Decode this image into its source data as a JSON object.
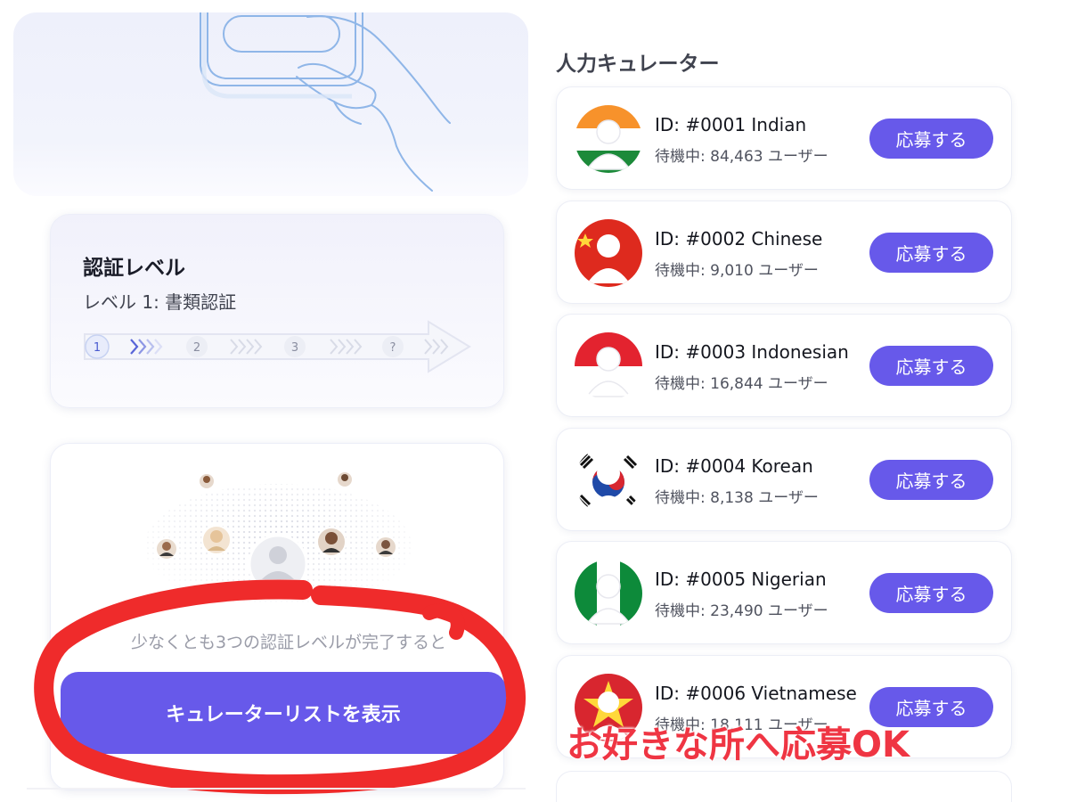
{
  "verification": {
    "title": "認証レベル",
    "subtitle": "レベル 1: 書類認証",
    "steps": [
      "1",
      "2",
      "3",
      "?"
    ]
  },
  "curator_promo": {
    "requirement_note": "少なくとも3つの認証レベルが完了すると",
    "show_list_label": "キュレーターリストを表示"
  },
  "curators": {
    "section_title": "人力キュレーター",
    "items": [
      {
        "name": "ID: #0001 Indian",
        "waiting": "待機中: 84,463 ユーザー",
        "apply_label": "応募する",
        "flag": "flag-india-icon"
      },
      {
        "name": "ID: #0002 Chinese",
        "waiting": "待機中: 9,010 ユーザー",
        "apply_label": "応募する",
        "flag": "flag-china-icon"
      },
      {
        "name": "ID: #0003 Indonesian",
        "waiting": "待機中: 16,844 ユーザー",
        "apply_label": "応募する",
        "flag": "flag-indonesia-icon"
      },
      {
        "name": "ID: #0004 Korean",
        "waiting": "待機中: 8,138 ユーザー",
        "apply_label": "応募する",
        "flag": "flag-korea-icon"
      },
      {
        "name": "ID: #0005 Nigerian",
        "waiting": "待機中: 23,490 ユーザー",
        "apply_label": "応募する",
        "flag": "flag-nigeria-icon"
      },
      {
        "name": "ID: #0006 Vietnamese",
        "waiting": "待機中: 18,111 ユーザー",
        "apply_label": "応募する",
        "flag": "flag-vietnam-icon"
      }
    ]
  },
  "annotation": {
    "overlay_text": "お好きな所へ応募OK"
  },
  "colors": {
    "accent": "#6759ea",
    "annotation_red": "#ef3543"
  }
}
